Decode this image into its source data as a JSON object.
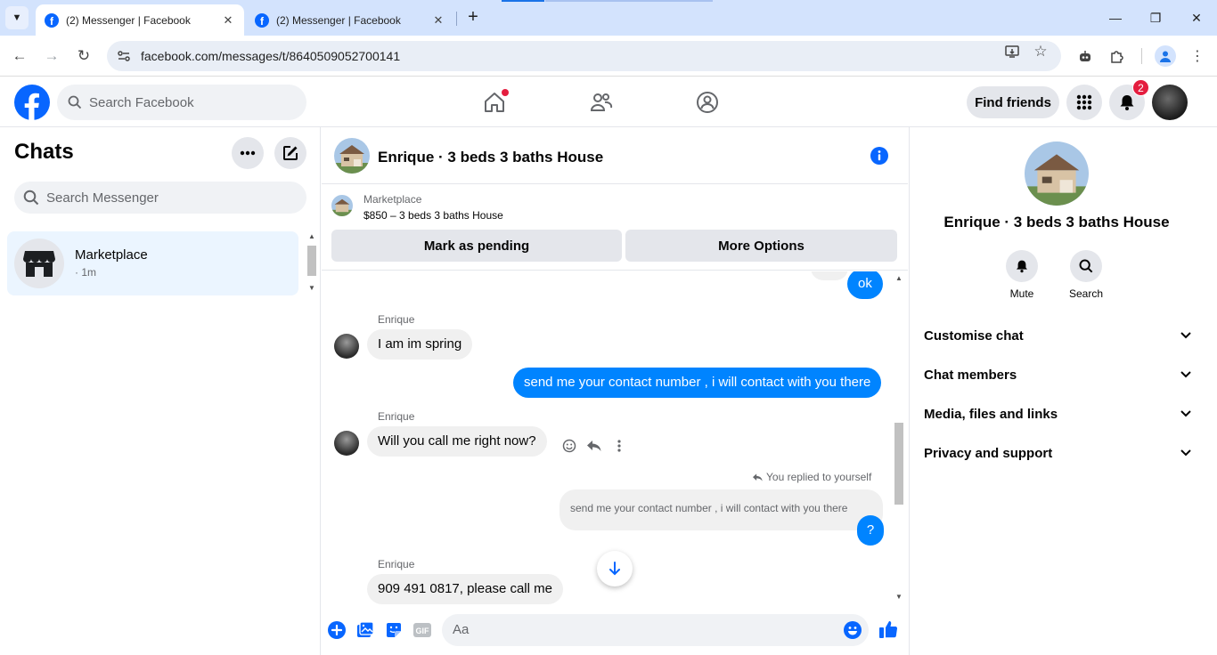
{
  "browser": {
    "tabs": [
      {
        "title": "(2) Messenger | Facebook",
        "active": true
      },
      {
        "title": "(2) Messenger | Facebook",
        "active": false
      }
    ],
    "url": "facebook.com/messages/t/8640509052700141"
  },
  "header": {
    "search_placeholder": "Search Facebook",
    "find_friends": "Find friends",
    "notification_count": "2"
  },
  "chats": {
    "title": "Chats",
    "search_placeholder": "Search Messenger",
    "items": [
      {
        "name": "Marketplace",
        "time": "· 1m"
      }
    ]
  },
  "conversation": {
    "title": "Enrique · 3 beds 3 baths House",
    "marketplace": {
      "label": "Marketplace",
      "listing": "$850 – 3 beds 3 baths House",
      "pending_button": "Mark as pending",
      "options_button": "More Options"
    },
    "messages": {
      "m1": "ok",
      "sender1": "Enrique",
      "m2": "I am im spring",
      "m3": "send me your contact number , i will contact with you there",
      "sender2": "Enrique",
      "m4": "Will you call me right now?",
      "reply_note": "You replied to yourself",
      "quoted": "send me your contact number , i will contact with you there",
      "m5": "?",
      "sender3": "Enrique",
      "m6": "909 491 0817, please call me"
    },
    "composer_placeholder": "Aa"
  },
  "info": {
    "name": "Enrique · 3 beds 3 baths House",
    "actions": [
      "Mute",
      "Search"
    ],
    "sections": [
      "Customise chat",
      "Chat members",
      "Media, files and links",
      "Privacy and support"
    ]
  },
  "colors": {
    "brand": "#0866ff",
    "outgoing_bubble": "#0084ff",
    "incoming_bubble": "#f0f0f0",
    "badge": "#e41e3f"
  }
}
